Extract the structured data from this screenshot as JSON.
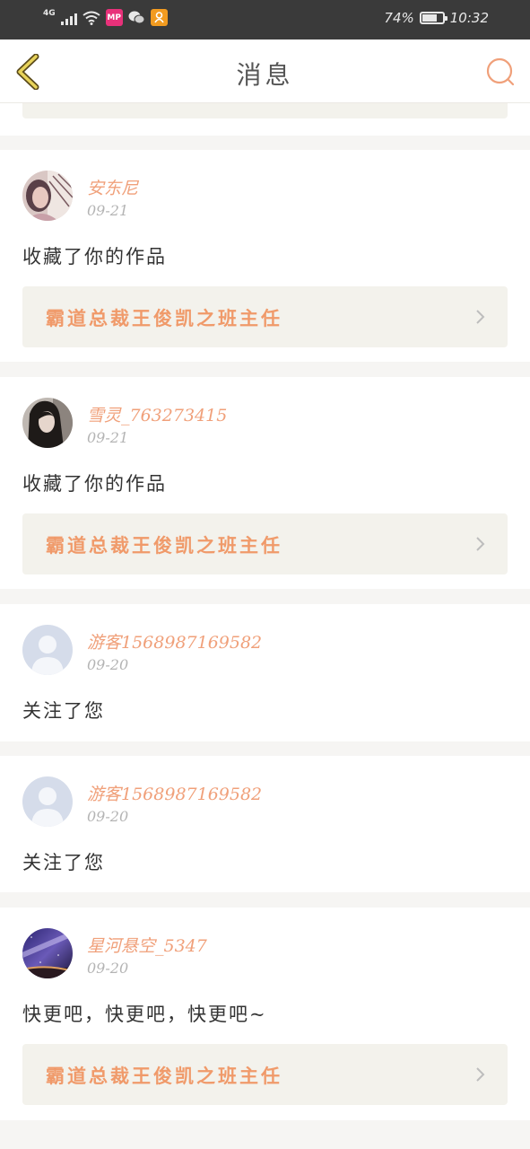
{
  "status_bar": {
    "network": "4G",
    "app_badge_mp": "MP",
    "app_badge_wechat": "wechat-icon",
    "app_badge_qzone": "qzone-icon",
    "battery_percent": "74%",
    "battery_level": 0.74,
    "time": "10:32"
  },
  "header": {
    "title": "消息",
    "back_icon": "chevron-left-icon",
    "search_icon": "search-icon",
    "accent_color": "#f0a07a"
  },
  "messages": [
    {
      "username": "安东尼",
      "date": "09-21",
      "text": "收藏了你的作品",
      "work_title": "霸道总裁王俊凯之班主任",
      "avatar": "photo-girl-icon"
    },
    {
      "username": "雪灵_763273415",
      "date": "09-21",
      "text": "收藏了你的作品",
      "work_title": "霸道总裁王俊凯之班主任",
      "avatar": "photo-girl-dark-icon"
    },
    {
      "username": "游客1568987169582",
      "date": "09-20",
      "text": "关注了您",
      "avatar": "default-user-icon"
    },
    {
      "username": "游客1568987169582",
      "date": "09-20",
      "text": "关注了您",
      "avatar": "default-user-icon"
    },
    {
      "username": "星河悬空_5347",
      "date": "09-20",
      "text": "快更吧，快更吧，快更吧~",
      "work_title": "霸道总裁王俊凯之班主任",
      "avatar": "photo-galaxy-icon"
    }
  ]
}
